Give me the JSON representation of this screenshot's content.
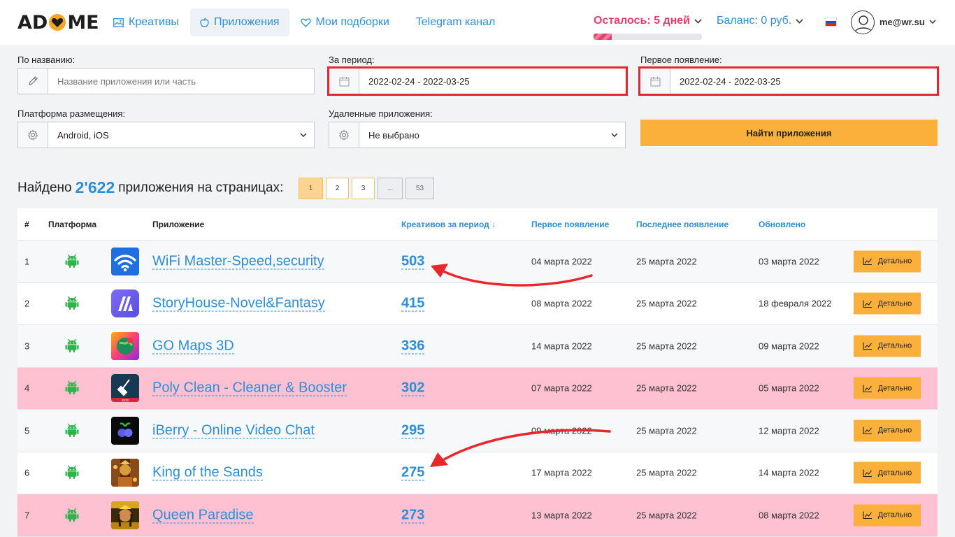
{
  "header": {
    "logo_left": "AD",
    "logo_right": "ME",
    "nav": [
      {
        "label": "Креативы",
        "icon": "image-icon"
      },
      {
        "label": "Приложения",
        "icon": "apple-icon",
        "active": true
      },
      {
        "label": "Мои подборки",
        "icon": "heart-icon"
      },
      {
        "label": "Telegram канал",
        "icon": ""
      }
    ],
    "days_left": "Осталось: 5 дней",
    "days_progress": 0.17,
    "balance": "Баланс: 0 руб.",
    "user_email": "me@wr.su"
  },
  "filters": {
    "name_label": "По названию:",
    "name_placeholder": "Название приложения или часть",
    "period_label": "За период:",
    "period_value": "2022-02-24 - 2022-03-25",
    "first_label": "Первое появление:",
    "first_value": "2022-02-24 - 2022-03-25",
    "platform_label": "Платформа размещения:",
    "platform_value": "Android, iOS",
    "deleted_label": "Удаленные приложения:",
    "deleted_value": "Не выбрано",
    "find_button": "Найти приложения"
  },
  "results": {
    "prefix": "Найдено",
    "count": "2'622",
    "suffix": "приложения на страницах:",
    "pages": [
      "1",
      "2",
      "3",
      "...",
      "53"
    ]
  },
  "table": {
    "headers": {
      "num": "#",
      "platform": "Платформа",
      "app": "Приложение",
      "creatives": "Креативов за период ↓",
      "first": "Первое появление",
      "last": "Последнее появление",
      "updated": "Обновлено"
    },
    "detail_label": "Детально",
    "rows": [
      {
        "num": "1",
        "name": "WiFi Master-Speed,security",
        "creatives": "503",
        "first": "04 марта 2022",
        "last": "25 марта 2022",
        "updated": "03 марта 2022",
        "icon": "wifi-app-icon"
      },
      {
        "num": "2",
        "name": "StoryHouse-Novel&Fantasy",
        "creatives": "415",
        "first": "08 марта 2022",
        "last": "25 марта 2022",
        "updated": "18 февраля 2022",
        "icon": "storyhouse-app-icon"
      },
      {
        "num": "3",
        "name": "GO Maps 3D",
        "creatives": "336",
        "first": "14 марта 2022",
        "last": "25 марта 2022",
        "updated": "09 марта 2022",
        "icon": "gomaps-app-icon"
      },
      {
        "num": "4",
        "name": "Poly Clean - Cleaner & Booster",
        "creatives": "302",
        "first": "07 марта 2022",
        "last": "25 марта 2022",
        "updated": "05 марта 2022",
        "icon": "polyclean-app-icon",
        "highlight": true
      },
      {
        "num": "5",
        "name": "iBerry - Online Video Chat",
        "creatives": "295",
        "first": "09 марта 2022",
        "last": "25 марта 2022",
        "updated": "12 марта 2022",
        "icon": "iberry-app-icon"
      },
      {
        "num": "6",
        "name": "King of the Sands",
        "creatives": "275",
        "first": "17 марта 2022",
        "last": "25 марта 2022",
        "updated": "14 марта 2022",
        "icon": "kingsands-app-icon"
      },
      {
        "num": "7",
        "name": "Queen Paradise",
        "creatives": "273",
        "first": "13 марта 2022",
        "last": "25 марта 2022",
        "updated": "08 марта 2022",
        "icon": "queenparadise-app-icon",
        "highlight": true
      }
    ]
  },
  "colors": {
    "accent": "#2e8ed8",
    "button": "#fbb03b",
    "highlight_row": "#fdc1d2",
    "annotation": "#e8262b",
    "days": "#e33f6b"
  }
}
